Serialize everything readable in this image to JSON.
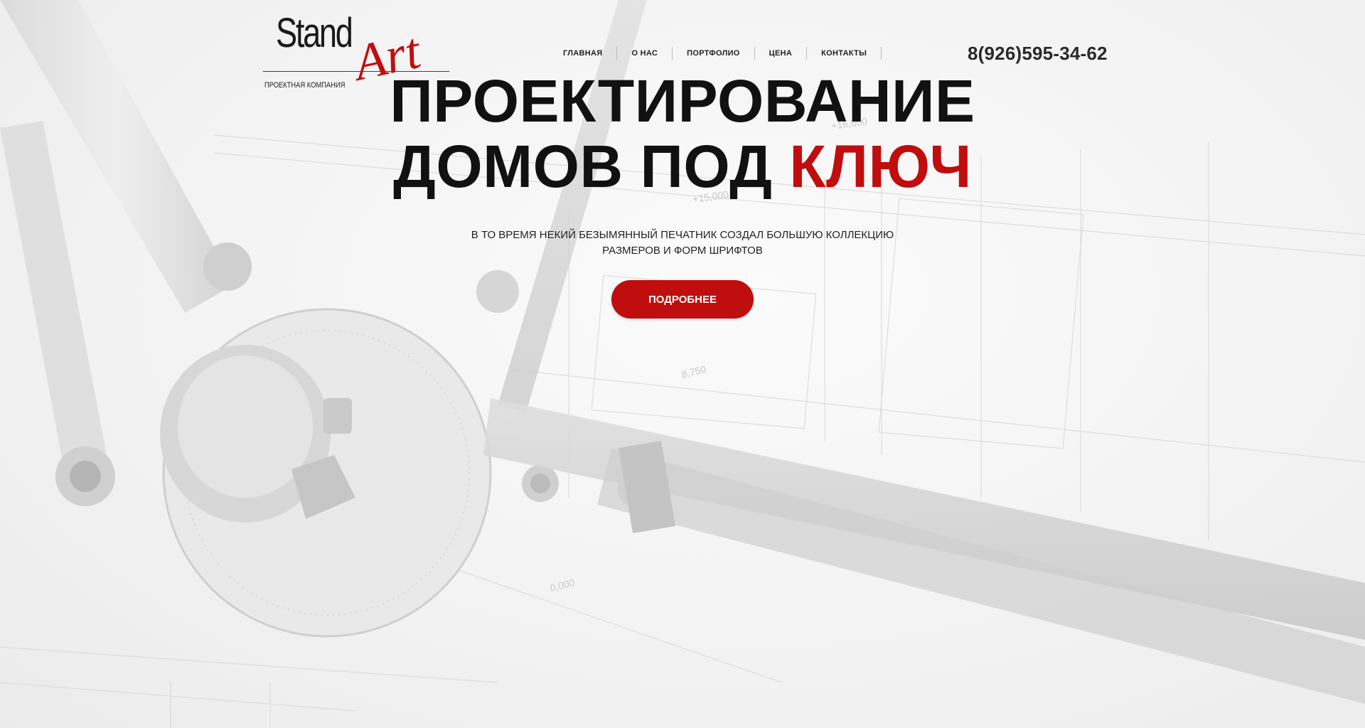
{
  "logo": {
    "word1": "Stand",
    "word2": "Art",
    "subtitle": "ПРОЕКТНАЯ КОМПАНИЯ"
  },
  "nav": {
    "items": [
      {
        "label": "ГЛАВНАЯ"
      },
      {
        "label": "О НАС"
      },
      {
        "label": "ПОРТФОЛИО"
      },
      {
        "label": "ЦЕНА"
      },
      {
        "label": "КОНТАКТЫ"
      }
    ]
  },
  "phone": "8(926)595-34-62",
  "hero": {
    "title_line1": "ПРОЕКТИРОВАНИЕ",
    "title_line2": "ДОМОВ ПОД",
    "title_accent": "КЛЮЧ",
    "subtitle": "В ТО ВРЕМЯ НЕКИЙ БЕЗЫМЯННЫЙ ПЕЧАТНИК СОЗДАЛ БОЛЬШУЮ КОЛЛЕКЦИЮ РАЗМЕРОВ И ФОРМ ШРИФТОВ",
    "button_label": "ПОДРОБНЕЕ"
  },
  "background": {
    "dim_labels": [
      "+16,600",
      "+15,000",
      "8,750",
      "0,000"
    ]
  },
  "colors": {
    "accent": "#c00d0d",
    "text": "#111111"
  }
}
